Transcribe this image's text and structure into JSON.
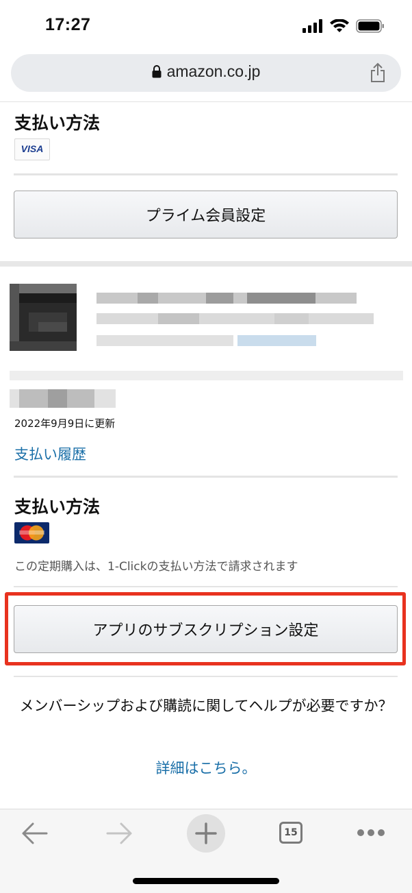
{
  "status": {
    "time": "17:27"
  },
  "browser": {
    "url": "amazon.co.jp",
    "tab_count": "15"
  },
  "payment_top": {
    "heading": "支払い方法",
    "card": "VISA"
  },
  "prime_button": "プライム会員設定",
  "subscription": {
    "updated": "2022年9月9日に更新",
    "history_link": "支払い履歴",
    "payment_heading": "支払い方法",
    "note": "この定期購入は、1-Clickの支払い方法で請求されます",
    "settings_button": "アプリのサブスクリプション設定"
  },
  "help": {
    "text": "メンバーシップおよび購読に関してヘルプが必要ですか？",
    "link": "詳細はこちら。"
  },
  "colors": {
    "link": "#1a6fa8",
    "highlight": "#e8321f"
  },
  "icons": [
    "signal-icon",
    "wifi-icon",
    "battery-icon",
    "lock-icon",
    "share-icon",
    "back-arrow-icon",
    "forward-arrow-icon",
    "new-tab-plus-icon",
    "tab-count-icon",
    "more-dots-icon",
    "mastercard-icon"
  ]
}
